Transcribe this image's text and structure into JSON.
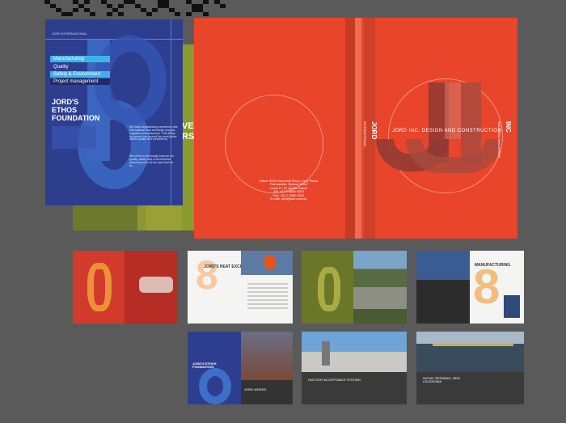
{
  "blue_cover": {
    "header": "JORD INTERNATIONAL",
    "menu": [
      "Manufacturing",
      "Quality",
      "Safety & Environment",
      "Project management"
    ],
    "title_lines": [
      "JORD'S",
      "ETHOS",
      "FOUNDATION"
    ],
    "body_1": "We have longstanding experience with international heat exchange projects, suppliers and customers. This ability to source from around the world gives clients quality and consistency.",
    "body_2": "We strive to continually improve our quality, safety and environmental performance in all the work that we do.",
    "colors": {
      "bg": "#2d3e8f",
      "accent": "#3fb3e8"
    }
  },
  "green_page": {
    "title_lines": [
      "VER",
      "RS"
    ]
  },
  "red_spread": {
    "contact_lines": [
      "Office: 6000 Devonhill Place, Cory Plains",
      "Parramatta, Sydney NSW",
      "Level 5 / 12 Seville Street",
      "Tel: +61 2 9680 0000",
      "Fax: +61 2 9680 0001",
      "E-mail: jord@jord.com.au"
    ],
    "spine_top": "JORD",
    "spine_sub": "INTERNATIONAL",
    "tagline": "JORD INC. DESIGN AND CONSTRUCTION",
    "right_spine": "INC",
    "right_spine_sub": "INDUSTRIAL INNOVATIONS",
    "logo_letters": "JJ",
    "colors": {
      "bg": "#e8452b"
    }
  },
  "thumbnails": {
    "heat_exchangers": "JORD'S HEAT EXCHANGERS",
    "manufacturing": "MANUFACTURING",
    "ethos": "JORD'S ETHOS FOUNDATION",
    "jord_works": "JORD WORKS",
    "acceptance": "FACTORY ACCEPTANCE TESTING",
    "nickel": "NICKEL REFINING, NEW CALEDONIA"
  }
}
